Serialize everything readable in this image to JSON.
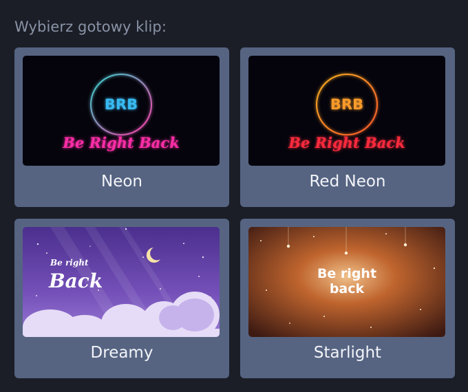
{
  "heading": "Wybierz gotowy klip:",
  "clips": [
    {
      "label": "Neon",
      "badge": "BRB",
      "caption": "Be Right Back",
      "colors": {
        "ring": "#2fd0d8",
        "badge": "#37b9f0",
        "caption": "#ff2ea8"
      }
    },
    {
      "label": "Red Neon",
      "badge": "BRB",
      "caption": "Be Right Back",
      "colors": {
        "ring": "#f5a623",
        "badge": "#f79a2c",
        "caption": "#ff2a3c"
      }
    },
    {
      "label": "Dreamy",
      "caption_small": "Be right",
      "caption_large": "Back"
    },
    {
      "label": "Starlight",
      "caption_line1": "Be right",
      "caption_line2": "back"
    }
  ]
}
